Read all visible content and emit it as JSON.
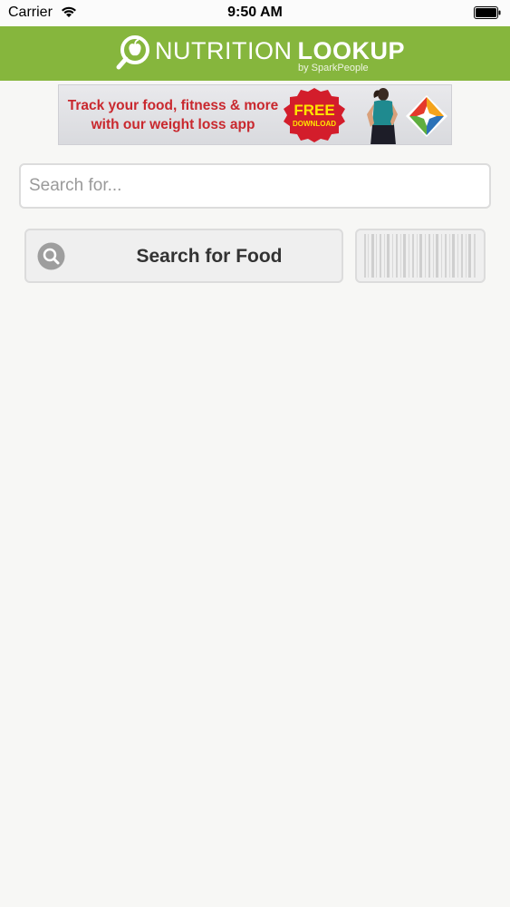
{
  "status_bar": {
    "carrier": "Carrier",
    "time": "9:50 AM"
  },
  "header": {
    "brand_part1": "NUTRITION",
    "brand_part2": "LOOKUP",
    "brand_sub": "by SparkPeople",
    "accent_color": "#86b63d"
  },
  "banner": {
    "line1": "Track your food, fitness & more",
    "line2": "with our weight loss app",
    "badge_line1": "FREE",
    "badge_line2": "DOWNLOAD"
  },
  "search": {
    "placeholder": "Search for..."
  },
  "actions": {
    "search_button_label": "Search for Food",
    "search_icon": "magnifier-icon",
    "barcode_icon": "barcode-icon"
  }
}
